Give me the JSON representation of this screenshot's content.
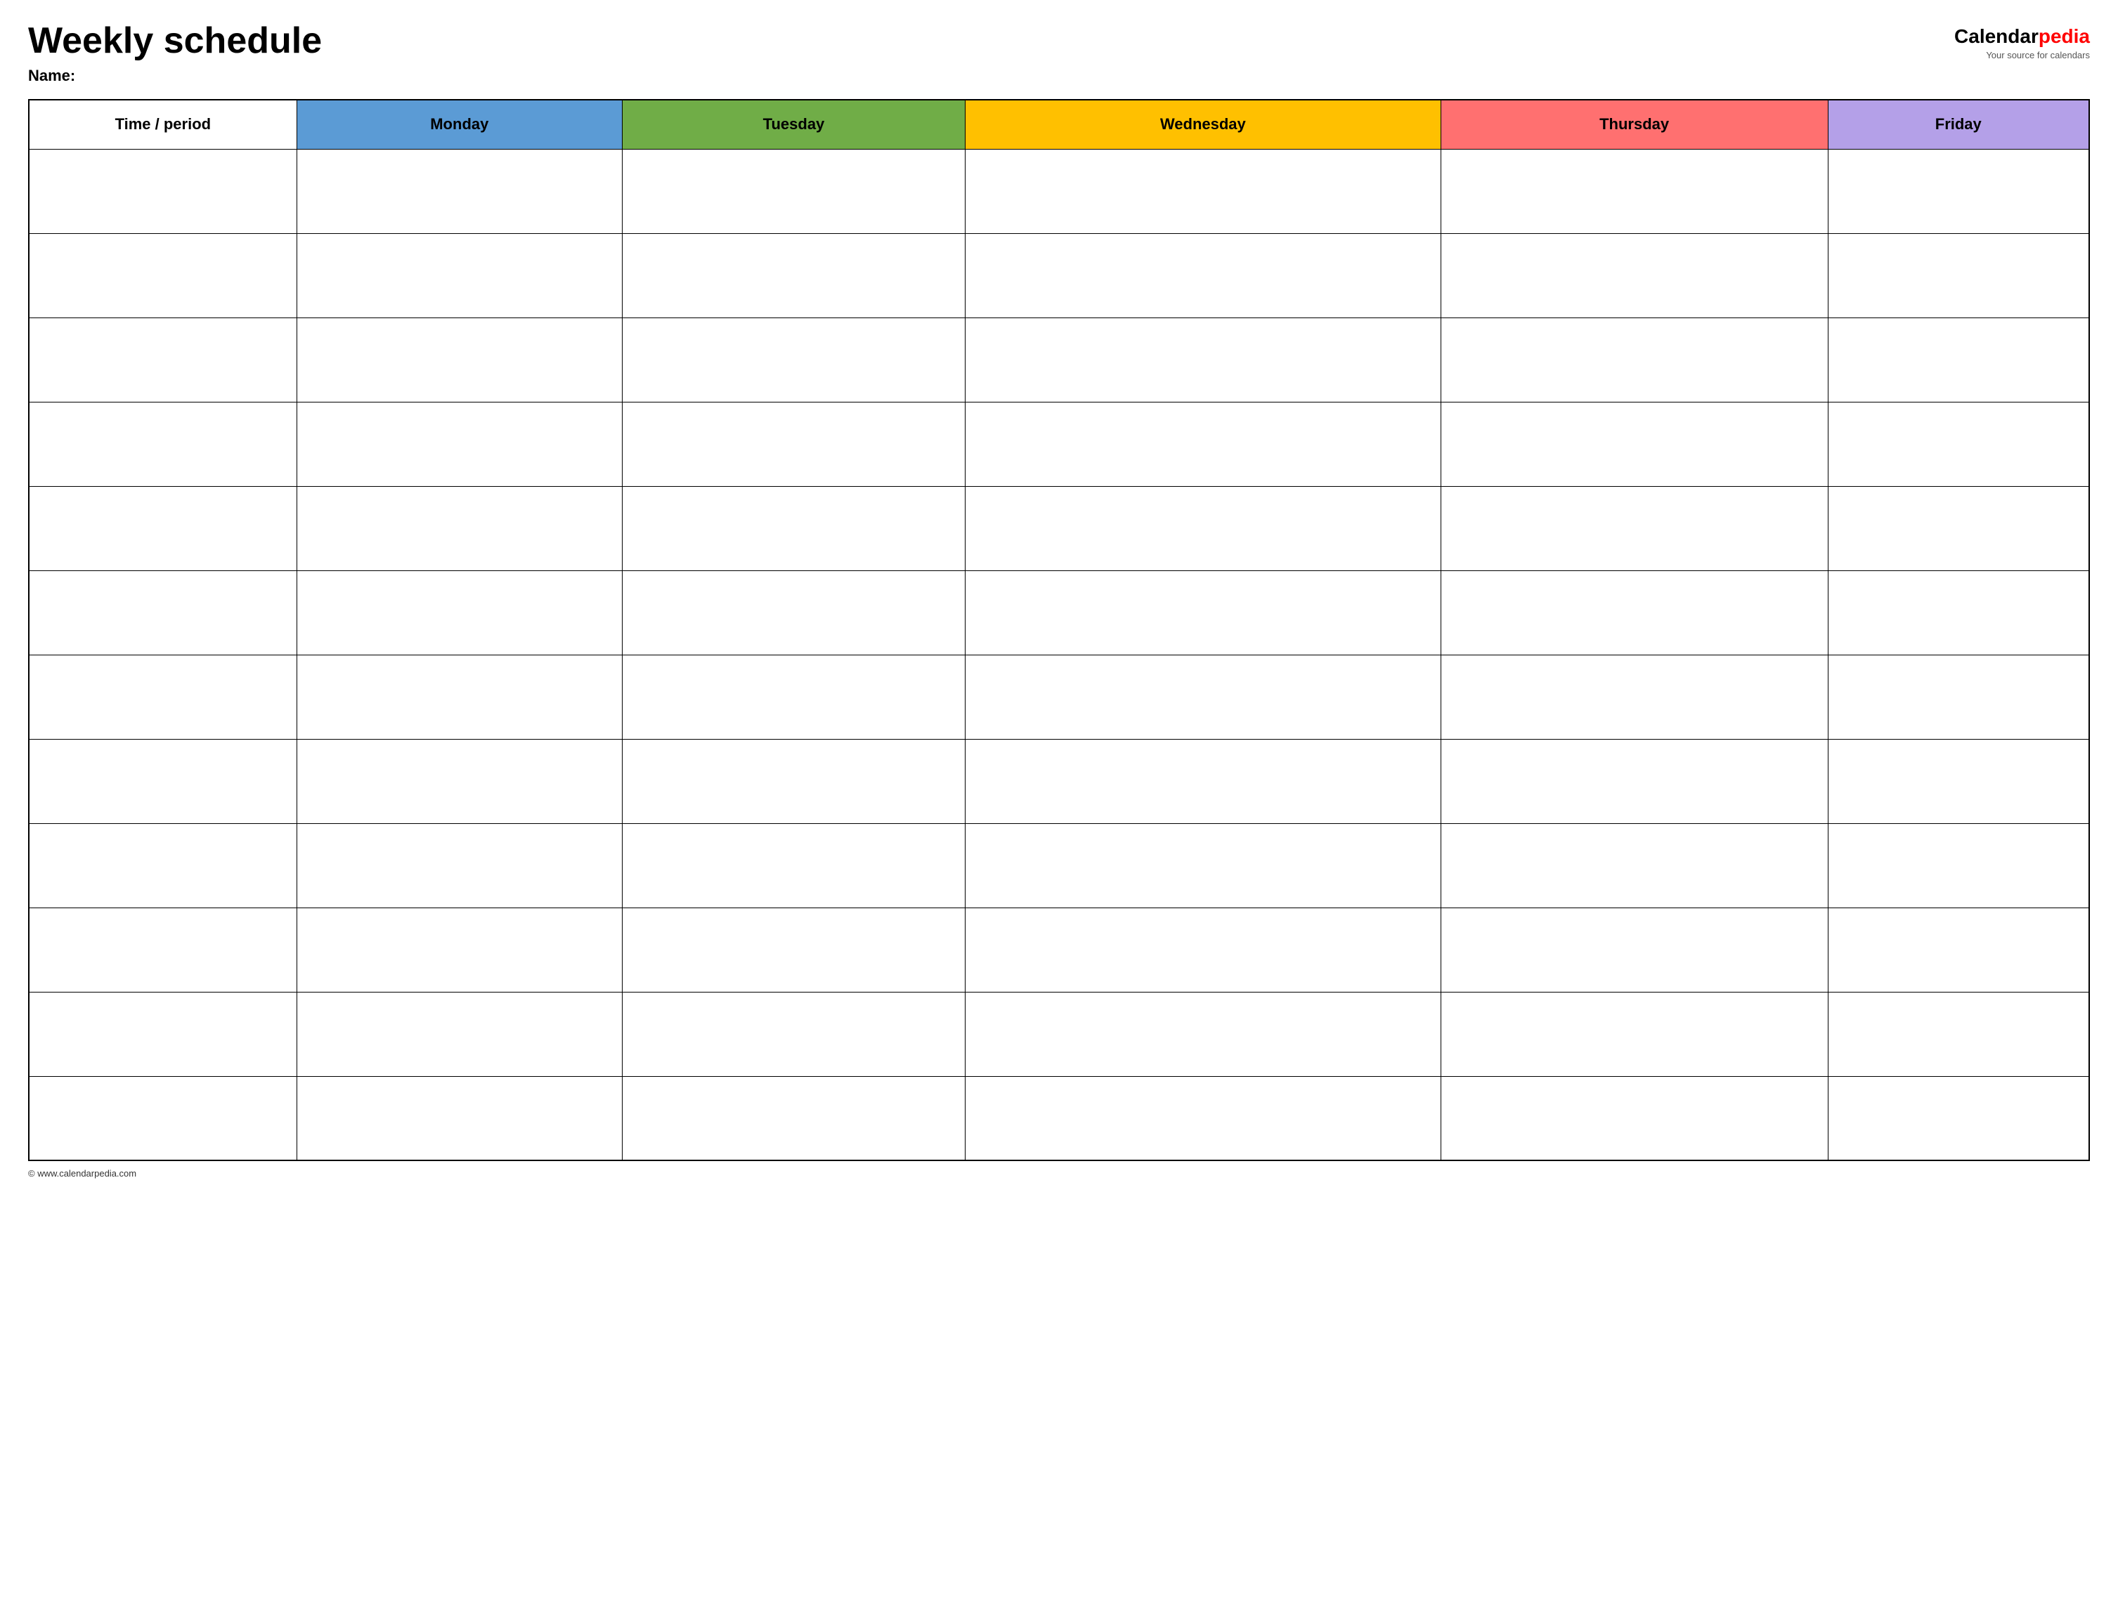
{
  "header": {
    "title": "Weekly schedule",
    "name_label": "Name:",
    "logo_calendar": "Calendar",
    "logo_pedia": "pedia",
    "logo_tagline": "Your source for calendars"
  },
  "table": {
    "columns": [
      {
        "id": "time",
        "label": "Time / period",
        "color": "#ffffff"
      },
      {
        "id": "monday",
        "label": "Monday",
        "color": "#5b9bd5"
      },
      {
        "id": "tuesday",
        "label": "Tuesday",
        "color": "#70ad47"
      },
      {
        "id": "wednesday",
        "label": "Wednesday",
        "color": "#ffc000"
      },
      {
        "id": "thursday",
        "label": "Thursday",
        "color": "#ff7070"
      },
      {
        "id": "friday",
        "label": "Friday",
        "color": "#b4a0e8"
      }
    ],
    "row_count": 12
  },
  "footer": {
    "copyright": "© www.calendarpedia.com"
  }
}
